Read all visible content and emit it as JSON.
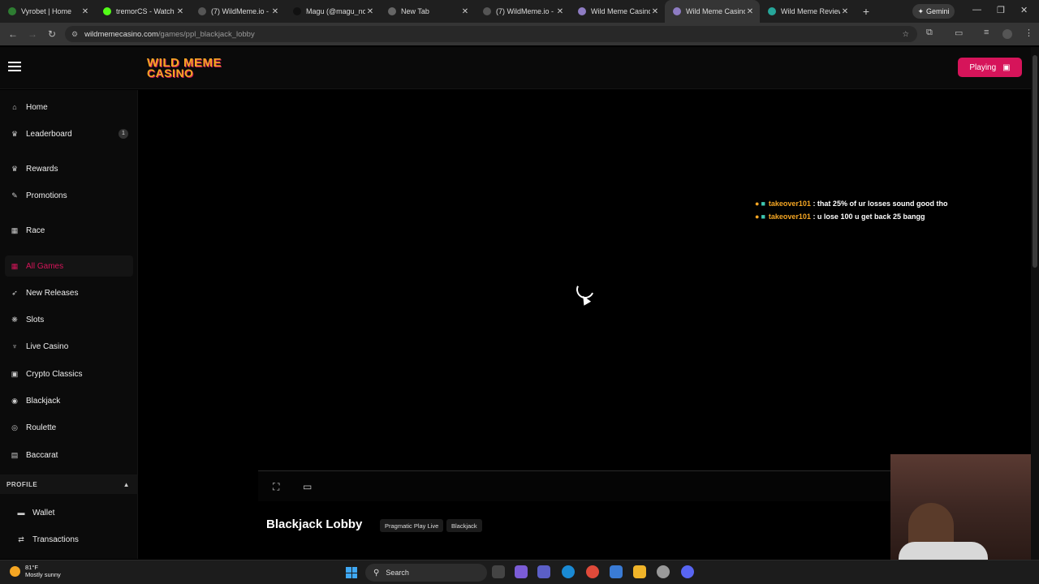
{
  "browser": {
    "tabs": [
      {
        "label": "Vyrobet | Home",
        "color": "#2e7d32"
      },
      {
        "label": "tremorCS - Watch",
        "color": "#53fc18"
      },
      {
        "label": "(7) WildMeme.io -",
        "color": "#555555"
      },
      {
        "label": "Magu (@magu_no",
        "color": "#111111"
      },
      {
        "label": "New Tab",
        "color": "#666666"
      },
      {
        "label": "(7) WildMeme.io -",
        "color": "#555555"
      },
      {
        "label": "Wild Meme Casino",
        "color": "#8e7cc3"
      },
      {
        "label": "Wild Meme Casino",
        "color": "#8e7cc3"
      },
      {
        "label": "Wild Meme Review",
        "color": "#26a69a"
      }
    ],
    "gemini_label": "Gemini",
    "url_host": "wildmemecasino.com",
    "url_path": "/games/ppl_blackjack_lobby"
  },
  "site": {
    "logo_line1": "WILD MEME",
    "logo_line2": "CASINO",
    "playing_label": "Playing",
    "accent": "#d6145a"
  },
  "sidebar": {
    "items": [
      {
        "label": "Home",
        "icon": "home-icon",
        "glyph": "⌂"
      },
      {
        "label": "Leaderboard",
        "icon": "trophy-icon",
        "glyph": "♛",
        "badge": "1"
      },
      {
        "label": "Rewards",
        "icon": "crown-icon",
        "glyph": "♛"
      },
      {
        "label": "Promotions",
        "icon": "megaphone-icon",
        "glyph": "✎"
      },
      {
        "label": "Race",
        "icon": "calendar-icon",
        "glyph": "▦"
      },
      {
        "label": "All Games",
        "icon": "grid-icon",
        "glyph": "▦"
      },
      {
        "label": "New Releases",
        "icon": "rocket-icon",
        "glyph": "➶"
      },
      {
        "label": "Slots",
        "icon": "slots-icon",
        "glyph": "❋"
      },
      {
        "label": "Live Casino",
        "icon": "live-icon",
        "glyph": "♆"
      },
      {
        "label": "Crypto Classics",
        "icon": "crypto-icon",
        "glyph": "▣"
      },
      {
        "label": "Blackjack",
        "icon": "blackjack-icon",
        "glyph": "◉"
      },
      {
        "label": "Roulette",
        "icon": "roulette-icon",
        "glyph": "◎"
      },
      {
        "label": "Baccarat",
        "icon": "baccarat-icon",
        "glyph": "▤"
      }
    ],
    "profile_header": "PROFILE",
    "profile_items": [
      {
        "label": "Wallet",
        "icon": "wallet-icon",
        "glyph": "▬"
      },
      {
        "label": "Transactions",
        "icon": "transactions-icon",
        "glyph": "⇄"
      }
    ]
  },
  "chat": [
    {
      "user": "takeover101",
      "text": ": that 25% of ur losses sound good tho"
    },
    {
      "user": "takeover101",
      "text": ": u lose 100 u get back 25 bangg"
    }
  ],
  "game": {
    "title": "Blackjack Lobby",
    "tags": [
      "Pragmatic Play Live",
      "Blackjack"
    ]
  },
  "taskbar": {
    "weather_temp": "81°F",
    "weather_desc": "Mostly sunny",
    "search_label": "Search"
  }
}
